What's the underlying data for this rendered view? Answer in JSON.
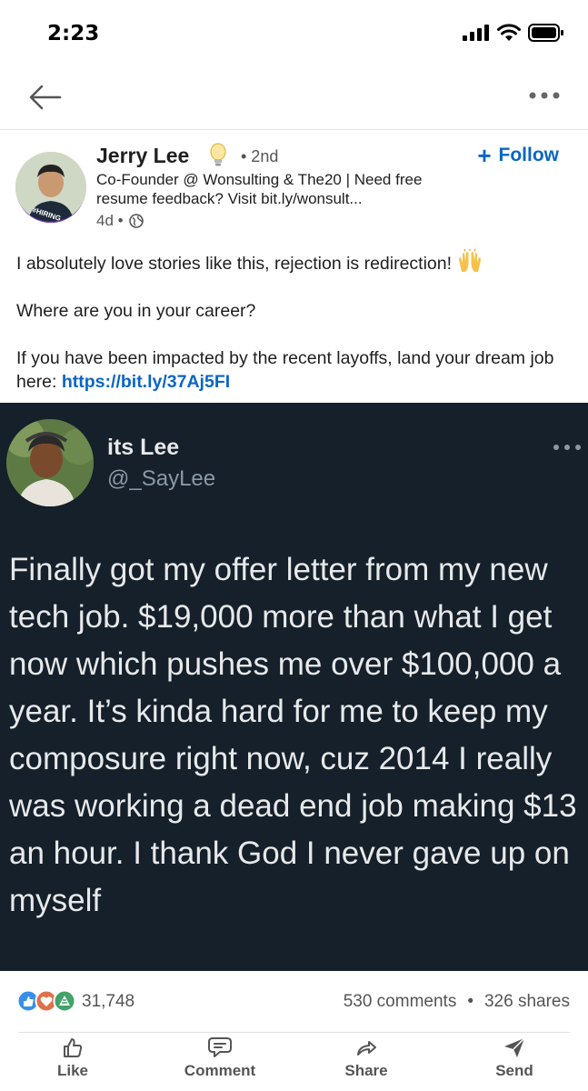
{
  "status_bar": {
    "time": "2:23",
    "icons": [
      "signal-icon",
      "wifi-icon",
      "battery-icon"
    ]
  },
  "nav": {
    "back_icon": "back-arrow-icon",
    "more_icon": "more-dots-icon"
  },
  "post": {
    "author": {
      "name": "Jerry Lee",
      "badge_icon": "lightbulb-icon",
      "degree": "• 2nd",
      "headline": "Co-Founder @ Wonsulting & The20 | Need free resume feedback? Visit bit.ly/wonsult...",
      "age": "4d •",
      "visibility_icon": "globe-icon",
      "avatar_badge": "#HIRING"
    },
    "follow_label": "Follow",
    "text": {
      "line1": "I absolutely love stories like this, rejection is redirection!",
      "line1_emoji": "raised-hands-icon",
      "line2": "Where are you in your career?",
      "line3": "If you have been impacted by the recent layoffs, land your dream job here:",
      "link": "https://bit.ly/37Aj5FI"
    }
  },
  "tweet": {
    "name": "its Lee",
    "handle": "@_SayLee",
    "body": "Finally got my offer letter from my new tech job. $19,000 more than what I get now which pushes me over $100,000 a year. It’s kinda hard for me to keep my composure right now, cuz 2014 I really was working a dead end job making $13 an hour. I thank God I never gave up on myself"
  },
  "stats": {
    "reaction_icons": [
      "like-reaction-icon",
      "love-reaction-icon",
      "celebrate-reaction-icon"
    ],
    "reactions": "31,748",
    "comments": "530 comments",
    "separator": "•",
    "shares": "326 shares"
  },
  "actions": {
    "like": "Like",
    "comment": "Comment",
    "share": "Share",
    "send": "Send"
  },
  "colors": {
    "accent": "#0a66c2",
    "tweet_bg": "#15202b",
    "hiring_badge": "#7b3fc7"
  }
}
